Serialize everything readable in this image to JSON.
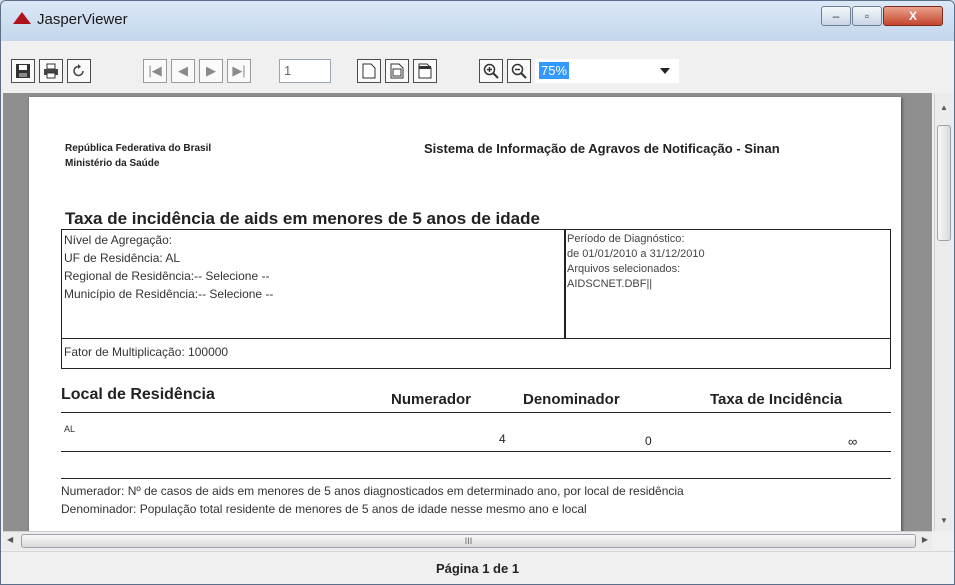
{
  "window": {
    "title": "JasperViewer"
  },
  "toolbar": {
    "page_number": "1",
    "zoom": "75%"
  },
  "report": {
    "org_line1": "República Federativa do Brasil",
    "org_line2": "Ministério da Saúde",
    "system_title": "Sistema de Informação de Agravos de Notificação - Sinan",
    "title": "Taxa de incidência de aids em menores de 5 anos de idade",
    "filters_left": [
      "Nível de Agregação:",
      "UF de Residência: AL",
      "Regional de Residência:-- Selecione --",
      "Município de Residência:-- Selecione --"
    ],
    "filters_right": [
      "Período de Diagnóstico:",
      "de 01/01/2010 a 31/12/2010",
      "Arquivos selecionados:",
      "AIDSCNET.DBF||"
    ],
    "multiplier": "Fator de Multiplicação: 100000",
    "columns": [
      "Local de Residência",
      "Numerador",
      "Denominador",
      "Taxa de Incidência"
    ],
    "row": {
      "local": "AL",
      "numerador": "4",
      "denominador": "0",
      "taxa": "∞"
    },
    "footnote1": "Numerador: Nº de casos de aids em menores de 5 anos diagnosticados em  determinado ano, por local de residência",
    "footnote2": "Denominador: População total residente de menores de 5 anos de idade nesse mesmo ano e local"
  },
  "status": {
    "text": "Página 1 de 1"
  }
}
